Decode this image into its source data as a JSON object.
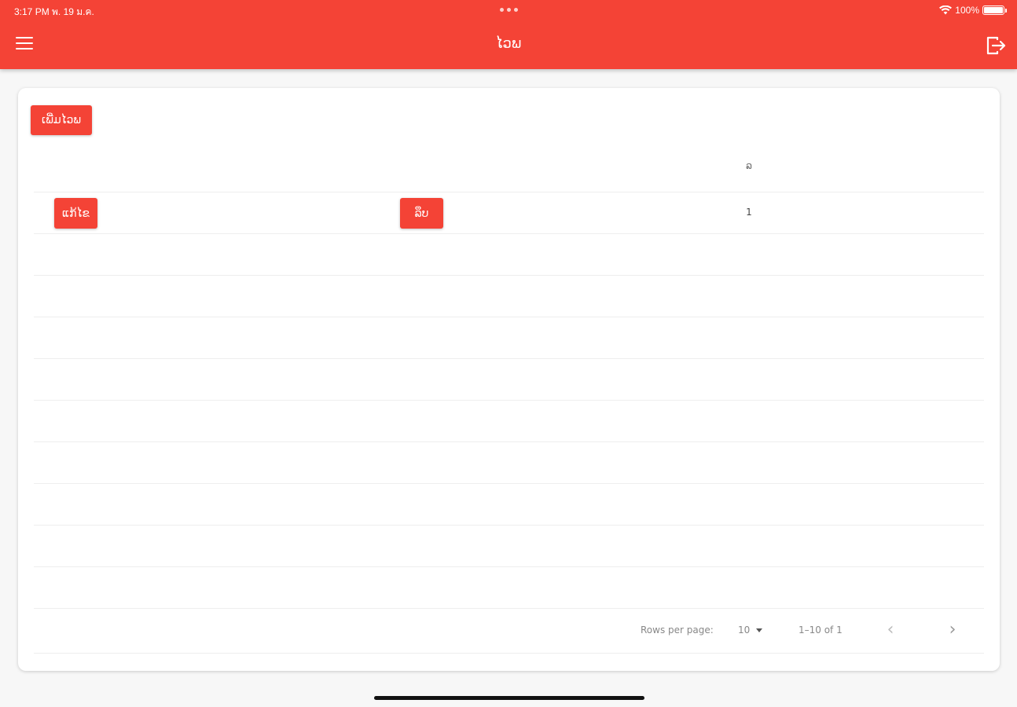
{
  "status_bar": {
    "time_date": "3:17 PM  พ. 19 ม.ค.",
    "battery": "100%"
  },
  "appbar": {
    "title": "ໄວພ"
  },
  "content": {
    "add_button": "ເພີ່ມໄວພ",
    "table": {
      "column_header": "ລ",
      "rows": [
        {
          "edit_label": "ແກ້ໄຂ",
          "delete_label": "ລຶບ",
          "value": "1"
        }
      ]
    },
    "pagination": {
      "rows_per_page_label": "Rows per page:",
      "rows_per_page_value": "10",
      "range_label": "1–10 of 1"
    }
  },
  "colors": {
    "primary": "#f44336",
    "background": "#f7f7f7"
  }
}
